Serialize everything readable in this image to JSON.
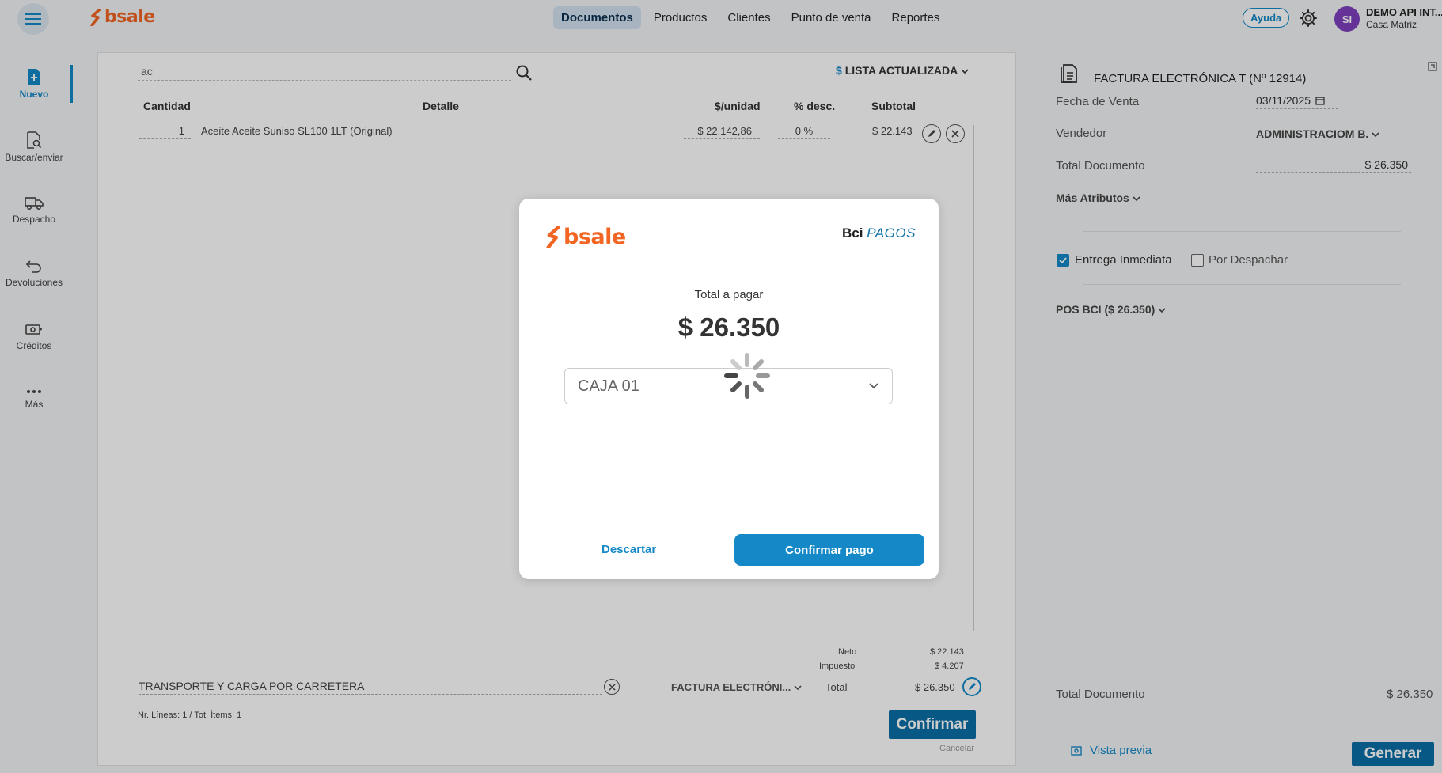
{
  "header": {
    "logo": "bsale",
    "nav": [
      "Documentos",
      "Productos",
      "Clientes",
      "Punto de venta",
      "Reportes"
    ],
    "help": "Ayuda",
    "avatar_initials": "SI",
    "user_name": "DEMO API INT...",
    "user_branch": "Casa Matriz"
  },
  "sidebar": {
    "items": [
      "Nuevo",
      "Buscar/enviar",
      "Despacho",
      "Devoluciones",
      "Créditos",
      "Más"
    ]
  },
  "main": {
    "search_value": "ac",
    "lista": "LISTA ACTUALIZADA",
    "lista_symbol": "$",
    "columns": [
      "Cantidad",
      "Detalle",
      "$/unidad",
      "% desc.",
      "Subtotal"
    ],
    "rows": [
      {
        "qty": "1",
        "detail": "Aceite Aceite Suniso SL100 1LT (Original)",
        "unit_price": "$ 22.142,86",
        "discount": "0 %",
        "subtotal": "$ 22.143"
      }
    ],
    "neto_label": "Neto",
    "neto_value": "$ 22.143",
    "impuesto_label": "Impuesto",
    "impuesto_value": "$ 4.207",
    "total_label": "Total",
    "total_value": "$ 26.350",
    "transporte": "TRANSPORTE Y CARGA POR CARRETERA",
    "doc_type": "FACTURA ELECTRÓNI...",
    "nr_lineas": "Nr. Líneas: 1 / Tot. Ítems: 1",
    "confirm": "Confirmar",
    "cancel": "Cancelar"
  },
  "right_panel": {
    "doc_title": "FACTURA ELECTRÓNICA T (Nº 12914)",
    "fecha_label": "Fecha de Venta",
    "fecha_value": "03/11/2025",
    "vendedor_label": "Vendedor",
    "vendedor_value": "ADMINISTRACIOM B.",
    "total_doc_label": "Total Documento",
    "total_doc_value": "$ 26.350",
    "mas_atributos": "Más Atributos",
    "entrega_inmediata": "Entrega Inmediata",
    "por_despachar": "Por Despachar",
    "pos": "POS BCI ($ 26.350)",
    "bottom_total_label": "Total Documento",
    "bottom_total_value": "$ 26.350",
    "vista_previa": "Vista previa",
    "generar": "Generar"
  },
  "modal": {
    "logo": "bsale",
    "bci_bold": "Bci",
    "bci_pagos": "PAGOS",
    "total_label": "Total a pagar",
    "total_amount": "$ 26.350",
    "caja_selected": "CAJA 01",
    "discard": "Descartar",
    "confirm_payment": "Confirmar pago"
  },
  "colors": {
    "brand_orange": "#f26522",
    "accent_blue": "#1589c8",
    "dark_blue": "#0b6fa8"
  }
}
